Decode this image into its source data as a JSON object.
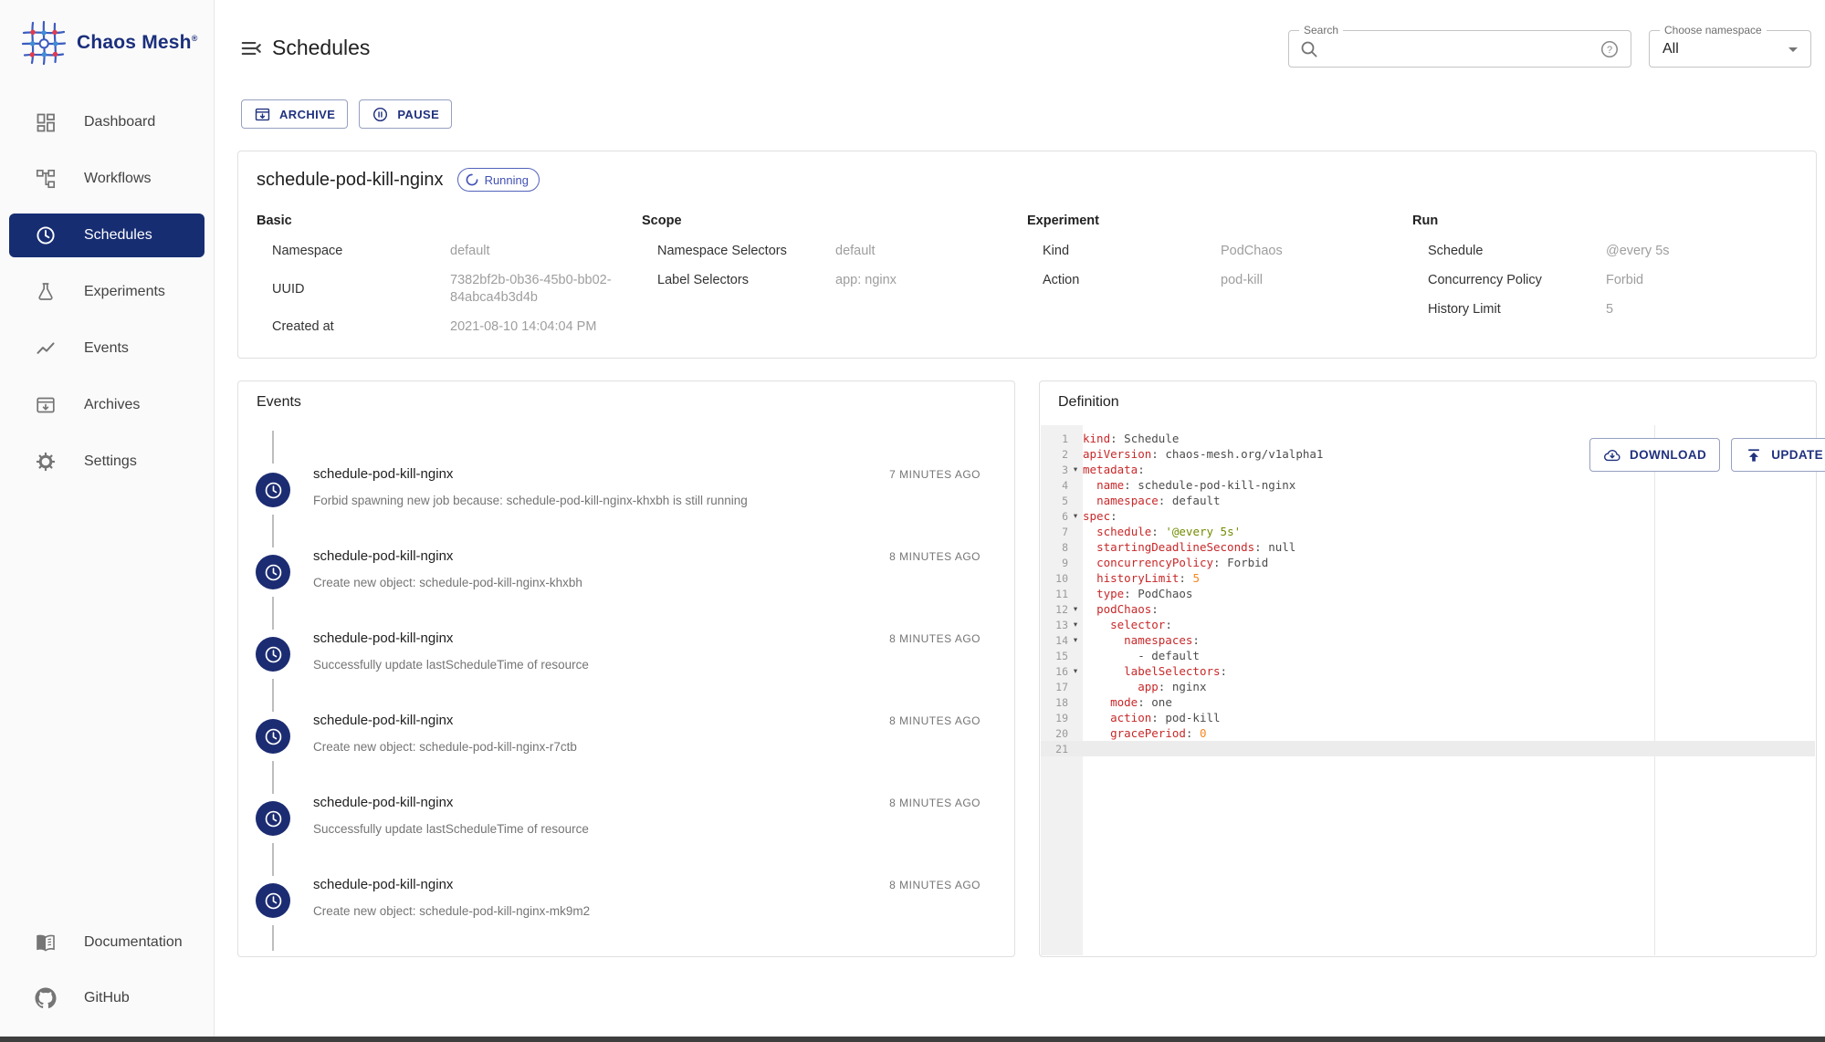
{
  "app": {
    "brand": "Chaos Mesh",
    "brand_mark": "®"
  },
  "colors": {
    "primary": "#172d72",
    "status_running": "#4150b5",
    "code_key": "#c82829",
    "code_string": "#718c00",
    "code_number": "#f5871f",
    "sidebar_bg": "#fafafa"
  },
  "sidebar": {
    "items": [
      {
        "label": "Dashboard",
        "icon": "dashboard-icon",
        "active": false
      },
      {
        "label": "Workflows",
        "icon": "workflows-icon",
        "active": false
      },
      {
        "label": "Schedules",
        "icon": "clock-icon",
        "active": true
      },
      {
        "label": "Experiments",
        "icon": "flask-icon",
        "active": false
      },
      {
        "label": "Events",
        "icon": "chart-line-icon",
        "active": false
      },
      {
        "label": "Archives",
        "icon": "archive-icon",
        "active": false
      },
      {
        "label": "Settings",
        "icon": "gear-icon",
        "active": false
      }
    ],
    "bottom_items": [
      {
        "label": "Documentation",
        "icon": "book-icon"
      },
      {
        "label": "GitHub",
        "icon": "github-icon"
      }
    ]
  },
  "header": {
    "title": "Schedules",
    "search_label": "Search",
    "namespace_label": "Choose namespace",
    "namespace_value": "All"
  },
  "toolbar": {
    "archive_label": "ARCHIVE",
    "pause_label": "PAUSE"
  },
  "detail": {
    "name": "schedule-pod-kill-nginx",
    "status": "Running",
    "sections": [
      {
        "title": "Basic",
        "rows": [
          [
            "Namespace",
            "default"
          ],
          [
            "UUID",
            "7382bf2b-0b36-45b0-bb02-84abca4b3d4b"
          ],
          [
            "Created at",
            "2021-08-10 14:04:04 PM"
          ]
        ]
      },
      {
        "title": "Scope",
        "rows": [
          [
            "Namespace Selectors",
            "default"
          ],
          [
            "Label Selectors",
            "app: nginx"
          ]
        ]
      },
      {
        "title": "Experiment",
        "rows": [
          [
            "Kind",
            "PodChaos"
          ],
          [
            "Action",
            "pod-kill"
          ]
        ]
      },
      {
        "title": "Run",
        "rows": [
          [
            "Schedule",
            "@every 5s"
          ],
          [
            "Concurrency Policy",
            "Forbid"
          ],
          [
            "History Limit",
            "5"
          ]
        ]
      }
    ]
  },
  "events": {
    "title": "Events",
    "items": [
      {
        "name": "schedule-pod-kill-nginx",
        "time": "7 MINUTES AGO",
        "message": "Forbid spawning new job because: schedule-pod-kill-nginx-khxbh is still running"
      },
      {
        "name": "schedule-pod-kill-nginx",
        "time": "8 MINUTES AGO",
        "message": "Create new object: schedule-pod-kill-nginx-khxbh"
      },
      {
        "name": "schedule-pod-kill-nginx",
        "time": "8 MINUTES AGO",
        "message": "Successfully update lastScheduleTime of resource"
      },
      {
        "name": "schedule-pod-kill-nginx",
        "time": "8 MINUTES AGO",
        "message": "Create new object: schedule-pod-kill-nginx-r7ctb"
      },
      {
        "name": "schedule-pod-kill-nginx",
        "time": "8 MINUTES AGO",
        "message": "Successfully update lastScheduleTime of resource"
      },
      {
        "name": "schedule-pod-kill-nginx",
        "time": "8 MINUTES AGO",
        "message": "Create new object: schedule-pod-kill-nginx-mk9m2"
      }
    ]
  },
  "definition": {
    "title": "Definition",
    "download_label": "DOWNLOAD",
    "update_label": "UPDATE",
    "code_lines": [
      {
        "n": 1,
        "fold": false,
        "active": false,
        "tokens": [
          [
            "key",
            "kind"
          ],
          [
            "p",
            ": "
          ],
          [
            "p",
            "Schedule"
          ]
        ]
      },
      {
        "n": 2,
        "fold": false,
        "active": false,
        "tokens": [
          [
            "key",
            "apiVersion"
          ],
          [
            "p",
            ": "
          ],
          [
            "p",
            "chaos-mesh.org/v1alpha1"
          ]
        ]
      },
      {
        "n": 3,
        "fold": true,
        "active": false,
        "tokens": [
          [
            "key",
            "metadata"
          ],
          [
            "p",
            ":"
          ]
        ]
      },
      {
        "n": 4,
        "fold": false,
        "active": false,
        "tokens": [
          [
            "p",
            "  "
          ],
          [
            "key",
            "name"
          ],
          [
            "p",
            ": "
          ],
          [
            "p",
            "schedule-pod-kill-nginx"
          ]
        ]
      },
      {
        "n": 5,
        "fold": false,
        "active": false,
        "tokens": [
          [
            "p",
            "  "
          ],
          [
            "key",
            "namespace"
          ],
          [
            "p",
            ": "
          ],
          [
            "p",
            "default"
          ]
        ]
      },
      {
        "n": 6,
        "fold": true,
        "active": false,
        "tokens": [
          [
            "key",
            "spec"
          ],
          [
            "p",
            ":"
          ]
        ]
      },
      {
        "n": 7,
        "fold": false,
        "active": false,
        "tokens": [
          [
            "p",
            "  "
          ],
          [
            "key",
            "schedule"
          ],
          [
            "p",
            ": "
          ],
          [
            "str",
            "'@every 5s'"
          ]
        ]
      },
      {
        "n": 8,
        "fold": false,
        "active": false,
        "tokens": [
          [
            "p",
            "  "
          ],
          [
            "key",
            "startingDeadlineSeconds"
          ],
          [
            "p",
            ": "
          ],
          [
            "p",
            "null"
          ]
        ]
      },
      {
        "n": 9,
        "fold": false,
        "active": false,
        "tokens": [
          [
            "p",
            "  "
          ],
          [
            "key",
            "concurrencyPolicy"
          ],
          [
            "p",
            ": "
          ],
          [
            "p",
            "Forbid"
          ]
        ]
      },
      {
        "n": 10,
        "fold": false,
        "active": false,
        "tokens": [
          [
            "p",
            "  "
          ],
          [
            "key",
            "historyLimit"
          ],
          [
            "p",
            ": "
          ],
          [
            "num",
            "5"
          ]
        ]
      },
      {
        "n": 11,
        "fold": false,
        "active": false,
        "tokens": [
          [
            "p",
            "  "
          ],
          [
            "key",
            "type"
          ],
          [
            "p",
            ": "
          ],
          [
            "p",
            "PodChaos"
          ]
        ]
      },
      {
        "n": 12,
        "fold": true,
        "active": false,
        "tokens": [
          [
            "p",
            "  "
          ],
          [
            "key",
            "podChaos"
          ],
          [
            "p",
            ":"
          ]
        ]
      },
      {
        "n": 13,
        "fold": true,
        "active": false,
        "tokens": [
          [
            "p",
            "    "
          ],
          [
            "key",
            "selector"
          ],
          [
            "p",
            ":"
          ]
        ]
      },
      {
        "n": 14,
        "fold": true,
        "active": false,
        "tokens": [
          [
            "p",
            "      "
          ],
          [
            "key",
            "namespaces"
          ],
          [
            "p",
            ":"
          ]
        ]
      },
      {
        "n": 15,
        "fold": false,
        "active": false,
        "tokens": [
          [
            "p",
            "        - default"
          ]
        ]
      },
      {
        "n": 16,
        "fold": true,
        "active": false,
        "tokens": [
          [
            "p",
            "      "
          ],
          [
            "key",
            "labelSelectors"
          ],
          [
            "p",
            ":"
          ]
        ]
      },
      {
        "n": 17,
        "fold": false,
        "active": false,
        "tokens": [
          [
            "p",
            "        "
          ],
          [
            "key",
            "app"
          ],
          [
            "p",
            ": "
          ],
          [
            "p",
            "nginx"
          ]
        ]
      },
      {
        "n": 18,
        "fold": false,
        "active": false,
        "tokens": [
          [
            "p",
            "    "
          ],
          [
            "key",
            "mode"
          ],
          [
            "p",
            ": "
          ],
          [
            "p",
            "one"
          ]
        ]
      },
      {
        "n": 19,
        "fold": false,
        "active": false,
        "tokens": [
          [
            "p",
            "    "
          ],
          [
            "key",
            "action"
          ],
          [
            "p",
            ": "
          ],
          [
            "p",
            "pod-kill"
          ]
        ]
      },
      {
        "n": 20,
        "fold": false,
        "active": false,
        "tokens": [
          [
            "p",
            "    "
          ],
          [
            "key",
            "gracePeriod"
          ],
          [
            "p",
            ": "
          ],
          [
            "num",
            "0"
          ]
        ]
      },
      {
        "n": 21,
        "fold": false,
        "active": true,
        "tokens": []
      }
    ]
  }
}
